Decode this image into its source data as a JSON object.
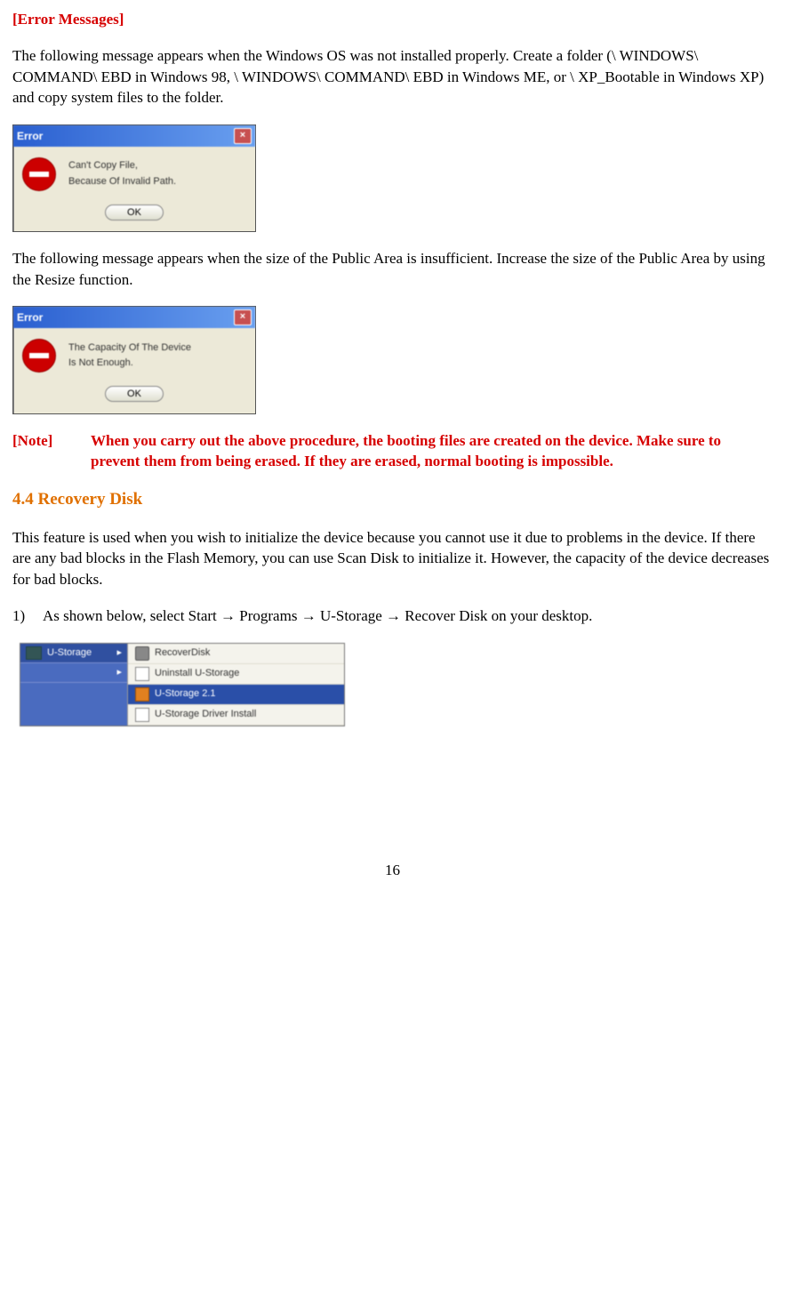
{
  "heading_errors": "[Error Messages]",
  "para1": "The following message appears when the Windows OS was not installed properly. Create a folder (\\ WINDOWS\\ COMMAND\\ EBD in Windows 98, \\ WINDOWS\\ COMMAND\\ EBD in Windows ME, or \\ XP_Bootable in Windows XP) and copy system files to the folder.",
  "dlg1": {
    "title": "Error",
    "line1": "Can't Copy File,",
    "line2": "Because Of Invalid Path.",
    "ok": "OK"
  },
  "para2": "The following message appears when the size of the Public Area is insufficient. Increase the size of the Public Area by using the Resize function.",
  "dlg2": {
    "title": "Error",
    "line1": "The Capacity Of The Device",
    "line2": "Is Not Enough.",
    "ok": "OK"
  },
  "note_label": "[Note]",
  "note_text": "When you carry out the above procedure, the booting files are created on the device. Make sure to prevent them from being erased. If they are erased, normal booting is impossible.",
  "section_heading": "4.4 Recovery Disk",
  "para3": "This feature is used when you wish to initialize the device because you cannot use it due to problems in the device. If there are any bad blocks in the Flash Memory, you can use Scan Disk to initialize it. However, the capacity of the device decreases for bad blocks.",
  "item1_num": "1)",
  "item1_text": "As shown below, select Start → Programs → U-Storage → Recover Disk on your desktop.",
  "menu": {
    "left": "U-Storage",
    "r1": "RecoverDisk",
    "r2": "Uninstall U-Storage",
    "r3": "U-Storage 2.1",
    "r4": "U-Storage Driver Install"
  },
  "page_number": "16"
}
